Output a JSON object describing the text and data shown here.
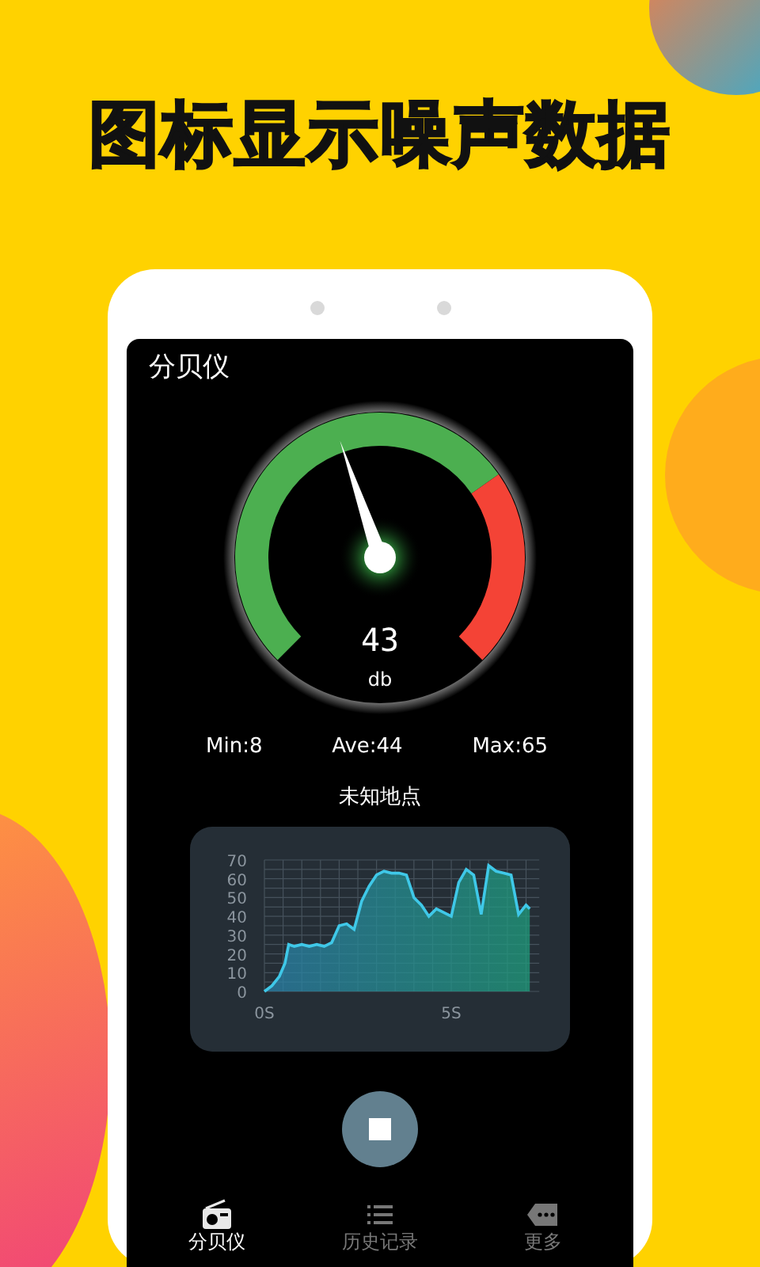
{
  "headline": "图标显示噪声数据",
  "app": {
    "title": "分贝仪",
    "gauge": {
      "reading": "43",
      "unit": "db"
    },
    "stats": [
      "Min:8",
      "Ave:44",
      "Max:65"
    ],
    "location": "未知地点",
    "chart_data": {
      "type": "area",
      "x": [
        0,
        0.2,
        0.4,
        0.55,
        0.65,
        0.8,
        1,
        1.2,
        1.4,
        1.6,
        1.8,
        2,
        2.2,
        2.4,
        2.6,
        2.8,
        3,
        3.2,
        3.4,
        3.6,
        3.8,
        4,
        4.2,
        4.4,
        4.6,
        4.8,
        5,
        5.2,
        5.4,
        5.6,
        5.8,
        6,
        6.2,
        6.4,
        6.6,
        6.8,
        7,
        7.1
      ],
      "series": [
        {
          "color": "#3fc8e8",
          "values": [
            0,
            3,
            8,
            15,
            25,
            24,
            25,
            24,
            25,
            24,
            26,
            35,
            36,
            33,
            48,
            56,
            62,
            64,
            63,
            63,
            62,
            50,
            46,
            40,
            44,
            42,
            40,
            58,
            65,
            62,
            41,
            67,
            64,
            63,
            62,
            41,
            46,
            44
          ]
        }
      ],
      "xlim": [
        0,
        7.1
      ],
      "ylim": [
        0,
        70
      ],
      "grid": true,
      "yticks": [
        0,
        10,
        20,
        30,
        40,
        50,
        60,
        70
      ],
      "xticks": [
        {
          "value": 0,
          "label": "0S"
        },
        {
          "value": 5,
          "label": "5S"
        }
      ]
    },
    "tabs": [
      {
        "label": "分贝仪",
        "selected": true
      },
      {
        "label": "历史记录",
        "selected": false
      },
      {
        "label": "更多",
        "selected": false
      }
    ]
  }
}
